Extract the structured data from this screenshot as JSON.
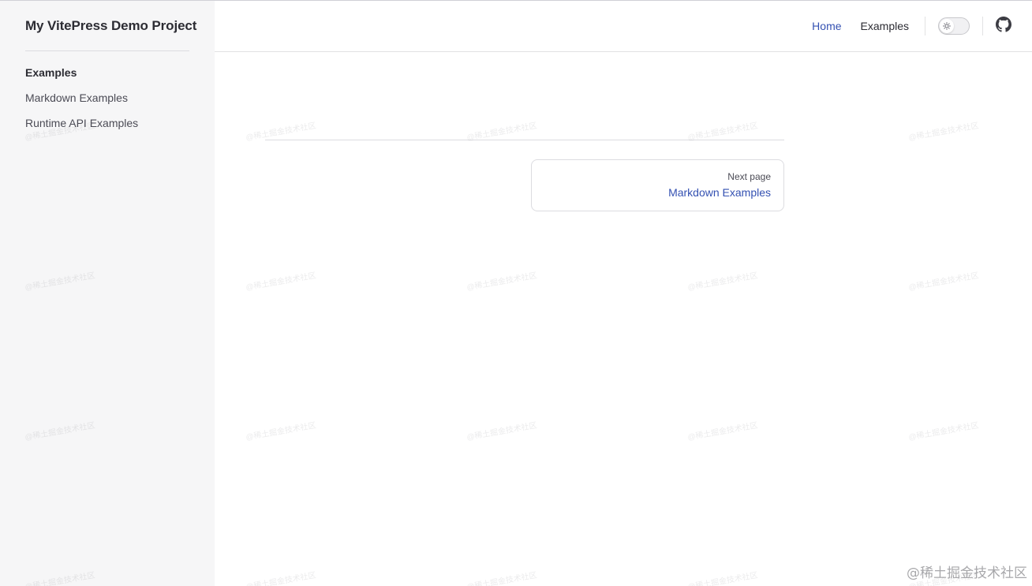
{
  "site": {
    "title": "My VitePress Demo Project"
  },
  "sidebar": {
    "group_title": "Examples",
    "items": [
      {
        "label": "Markdown Examples"
      },
      {
        "label": "Runtime API Examples"
      }
    ]
  },
  "nav": {
    "links": [
      {
        "label": "Home",
        "active": true
      },
      {
        "label": "Examples",
        "active": false
      }
    ],
    "theme_toggle_icon": "sun-icon",
    "social_icon": "github-icon"
  },
  "pager": {
    "next_label": "Next page",
    "next_title": "Markdown Examples"
  },
  "watermark": {
    "text": "@稀土掘金技术社区"
  },
  "colors": {
    "brand": "#3451b2",
    "sidebar_bg": "#f6f6f7",
    "divider": "#e2e2e3"
  }
}
